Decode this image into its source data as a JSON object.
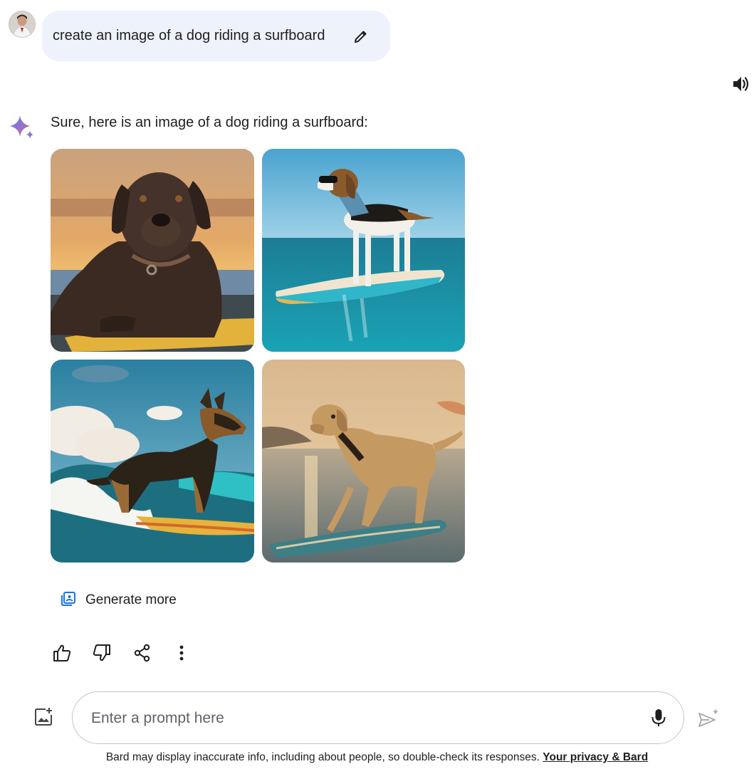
{
  "user_prompt": {
    "text": "create an image of a dog riding a surfboard",
    "avatar_icon": "user-avatar",
    "edit_icon": "pencil-icon"
  },
  "response": {
    "text": "Sure, here is an image of a dog riding a surfboard:",
    "images": [
      {
        "subject": "chocolate labrador on surfboard at sunset"
      },
      {
        "subject": "beagle with sunglasses and bandana on paddleboard"
      },
      {
        "subject": "german shepherd surfing a wave"
      },
      {
        "subject": "golden labrador on surfboard at sunset"
      }
    ],
    "generate_more_label": "Generate more"
  },
  "actions": [
    "thumb-up-icon",
    "thumb-down-icon",
    "share-icon",
    "more-vert-icon"
  ],
  "input": {
    "placeholder": "Enter a prompt here",
    "value": ""
  },
  "footer": {
    "text": "Bard may display inaccurate info, including about people, so double-check its responses.",
    "link": "Your privacy & Bard"
  },
  "colors": {
    "bubble_bg": "#eef2fb",
    "accent_blue": "#4285f4",
    "text": "#1f1f1f"
  }
}
